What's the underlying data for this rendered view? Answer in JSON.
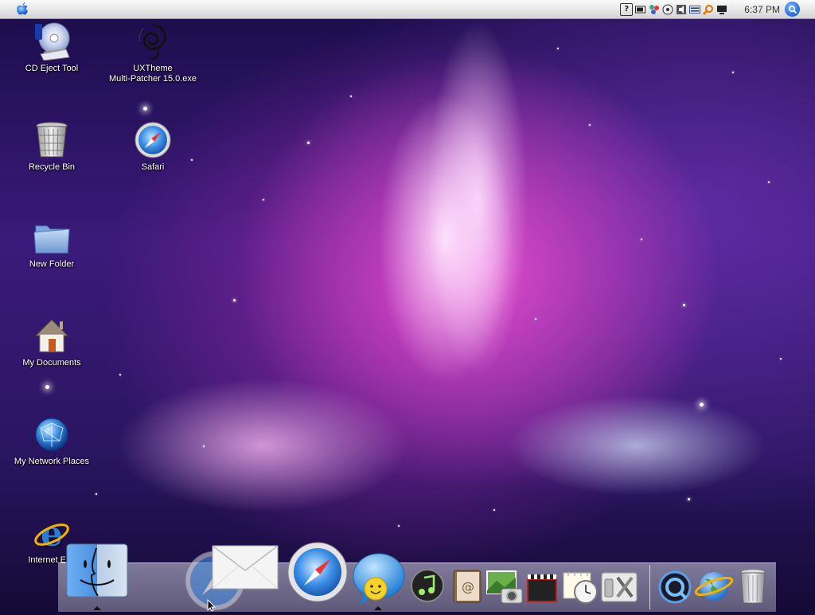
{
  "menubar": {
    "clock": "6:37 PM",
    "tray_icons": [
      "help-icon",
      "battery-icon",
      "network-icon",
      "disc-icon",
      "volume-icon",
      "keyboard-icon",
      "search-magnifier-icon",
      "display-icon"
    ]
  },
  "desktop": {
    "icons": [
      {
        "label": "CD Eject Tool"
      },
      {
        "label": "UXTheme\nMulti-Patcher 15.0.exe"
      },
      {
        "label": "Recycle Bin"
      },
      {
        "label": "Safari"
      },
      {
        "label": "New Folder"
      },
      {
        "label": "My Documents"
      },
      {
        "label": "My Network Places"
      },
      {
        "label": "Internet Exp"
      }
    ]
  },
  "dock": {
    "items": [
      "finder",
      "safari-dragging",
      "mail",
      "safari",
      "ichat",
      "itunes",
      "address-book",
      "iphoto",
      "imovie",
      "ical-clock",
      "system-utilities",
      "quicktime",
      "internet-explorer",
      "trash"
    ]
  },
  "colors": {
    "menubar_top": "#fbfbfb",
    "menubar_bottom": "#d4d4d4",
    "wallpaper_pink": "#ee50d2",
    "wallpaper_purple": "#3a1a7a",
    "spotlight_blue": "#2a6fd8"
  }
}
